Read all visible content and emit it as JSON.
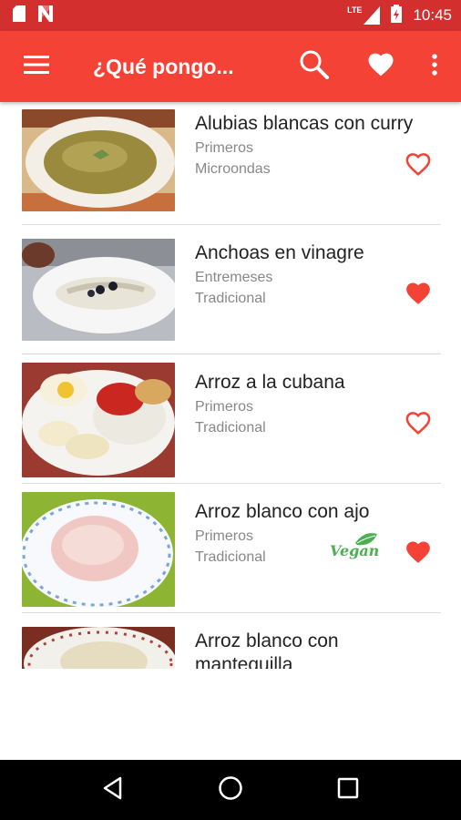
{
  "status_bar": {
    "time": "10:45",
    "network": "LTE"
  },
  "app_bar": {
    "title": "¿Qué pongo..."
  },
  "recipes": [
    {
      "title": "Alubias blancas con curry",
      "category": "Primeros",
      "method": "Microondas",
      "favorite": false,
      "vegan": false
    },
    {
      "title": "Anchoas en vinagre",
      "category": "Entremeses",
      "method": "Tradicional",
      "favorite": true,
      "vegan": false
    },
    {
      "title": "Arroz a la cubana",
      "category": "Primeros",
      "method": "Tradicional",
      "favorite": false,
      "vegan": false
    },
    {
      "title": "Arroz blanco con ajo",
      "category": "Primeros",
      "method": "Tradicional",
      "favorite": true,
      "vegan": true,
      "vegan_label": "Vegan"
    },
    {
      "title": "Arroz blanco con",
      "title_line2": "mantequilla"
    }
  ],
  "icons": {
    "menu": "hamburger-menu-icon",
    "search": "search-icon",
    "favorites": "heart-icon",
    "more": "more-vert-icon",
    "back": "back-triangle-icon",
    "home": "home-circle-icon",
    "recents": "recents-square-icon"
  },
  "colors": {
    "status_bar": "#d32f2f",
    "app_bar": "#f44336",
    "heart": "#f44336",
    "vegan": "#4caf50"
  }
}
